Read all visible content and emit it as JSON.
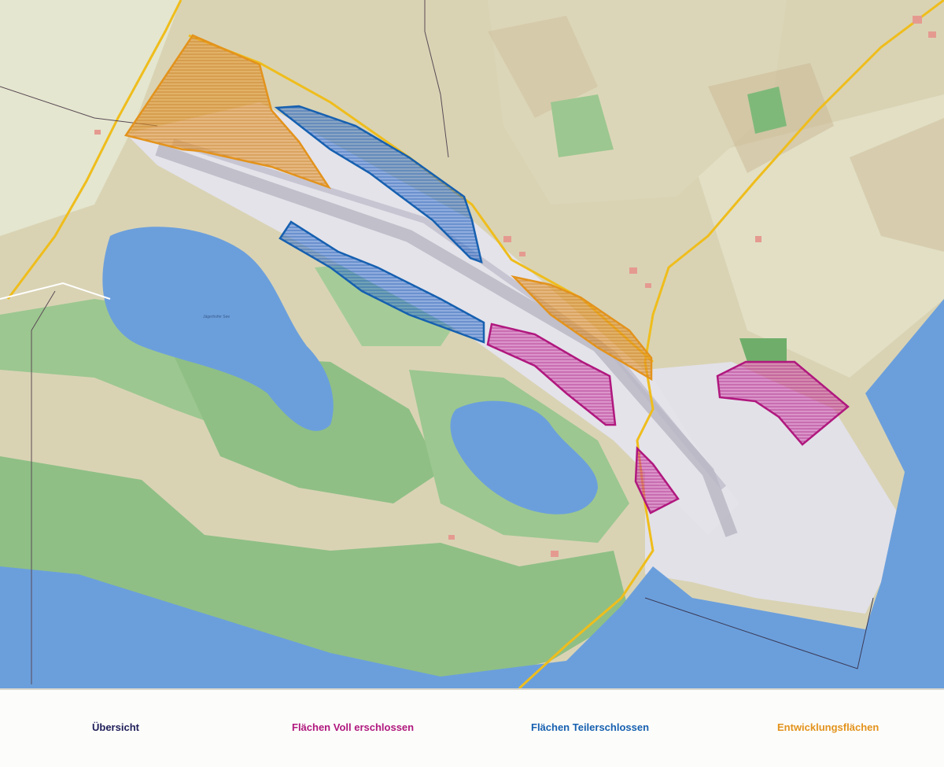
{
  "legend": {
    "overview": "Übersicht",
    "full": "Flächen Voll erschlossen",
    "partial": "Flächen Teilerschlossen",
    "development": "Entwicklungsflächen"
  },
  "colors": {
    "land": "#d8d2b3",
    "forest": "#8fbf85",
    "water": "#6b9fdc",
    "developed_area": "#e0dfe6",
    "road": "#efbd1c",
    "full_developed": "#b0187e",
    "partial_developed": "#1660b0",
    "development": "#e3931c"
  },
  "map": {
    "lake_label": "Jägerhofer See"
  }
}
